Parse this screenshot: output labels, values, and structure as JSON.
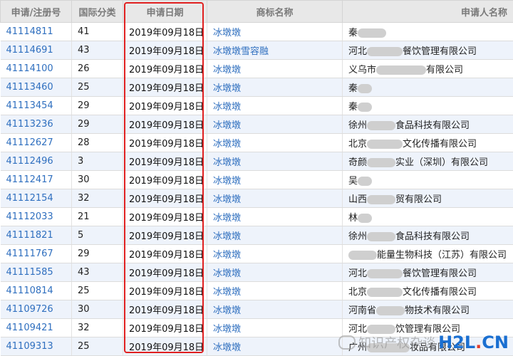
{
  "table": {
    "headers": [
      "申请/注册号",
      "国际分类",
      "申请日期",
      "商标名称",
      "申请人名称"
    ],
    "rows": [
      {
        "number": "41114811",
        "class": "41",
        "date": "2019年09月18日",
        "mark": "冰墩墩",
        "applicant_prefix": "秦",
        "applicant_suffix": ""
      },
      {
        "number": "41114691",
        "class": "43",
        "date": "2019年09月18日",
        "mark": "冰墩墩雪容融",
        "applicant_prefix": "河北",
        "applicant_suffix": "餐饮管理有限公司"
      },
      {
        "number": "41114100",
        "class": "26",
        "date": "2019年09月18日",
        "mark": "冰墩墩",
        "applicant_prefix": "义乌市",
        "applicant_suffix": "有限公司"
      },
      {
        "number": "41113460",
        "class": "25",
        "date": "2019年09月18日",
        "mark": "冰墩墩",
        "applicant_prefix": "秦",
        "applicant_suffix": ""
      },
      {
        "number": "41113454",
        "class": "29",
        "date": "2019年09月18日",
        "mark": "冰墩墩",
        "applicant_prefix": "秦",
        "applicant_suffix": ""
      },
      {
        "number": "41113236",
        "class": "29",
        "date": "2019年09月18日",
        "mark": "冰墩墩",
        "applicant_prefix": "徐州",
        "applicant_suffix": "食品科技有限公司"
      },
      {
        "number": "41112627",
        "class": "28",
        "date": "2019年09月18日",
        "mark": "冰墩墩",
        "applicant_prefix": "北京",
        "applicant_suffix": "文化传播有限公司"
      },
      {
        "number": "41112496",
        "class": "3",
        "date": "2019年09月18日",
        "mark": "冰墩墩",
        "applicant_prefix": "奇颜",
        "applicant_suffix": "实业（深圳）有限公司"
      },
      {
        "number": "41112417",
        "class": "30",
        "date": "2019年09月18日",
        "mark": "冰墩墩",
        "applicant_prefix": "吴",
        "applicant_suffix": ""
      },
      {
        "number": "41112154",
        "class": "32",
        "date": "2019年09月18日",
        "mark": "冰墩墩",
        "applicant_prefix": "山西",
        "applicant_suffix": "贸有限公司"
      },
      {
        "number": "41112033",
        "class": "21",
        "date": "2019年09月18日",
        "mark": "冰墩墩",
        "applicant_prefix": "林",
        "applicant_suffix": ""
      },
      {
        "number": "41111821",
        "class": "5",
        "date": "2019年09月18日",
        "mark": "冰墩墩",
        "applicant_prefix": "徐州",
        "applicant_suffix": "食品科技有限公司"
      },
      {
        "number": "41111767",
        "class": "29",
        "date": "2019年09月18日",
        "mark": "冰墩墩",
        "applicant_prefix": "",
        "applicant_suffix": "能量生物科技（江苏）有限公司"
      },
      {
        "number": "41111585",
        "class": "43",
        "date": "2019年09月18日",
        "mark": "冰墩墩",
        "applicant_prefix": "河北",
        "applicant_suffix": "餐饮管理有限公司"
      },
      {
        "number": "41110814",
        "class": "25",
        "date": "2019年09月18日",
        "mark": "冰墩墩",
        "applicant_prefix": "北京",
        "applicant_suffix": "文化传播有限公司"
      },
      {
        "number": "41109726",
        "class": "30",
        "date": "2019年09月18日",
        "mark": "冰墩墩",
        "applicant_prefix": "河南省",
        "applicant_suffix": "物技术有限公司"
      },
      {
        "number": "41109421",
        "class": "32",
        "date": "2019年09月18日",
        "mark": "冰墩墩",
        "applicant_prefix": "河北",
        "applicant_suffix": "饮管理有限公司"
      },
      {
        "number": "41109313",
        "class": "25",
        "date": "2019年09月18日",
        "mark": "冰墩墩",
        "applicant_prefix": "广州",
        "applicant_suffix": "妆品有限公司"
      }
    ]
  },
  "watermark": {
    "text": "知识产权杂谈",
    "logo_main": "H2L",
    "logo_dot": ".",
    "logo_tld": "CN"
  },
  "colors": {
    "link": "#2f6fbf",
    "highlight": "#e02020",
    "header_bg": "#e8e8e8",
    "alt_row": "#eef3fb"
  }
}
